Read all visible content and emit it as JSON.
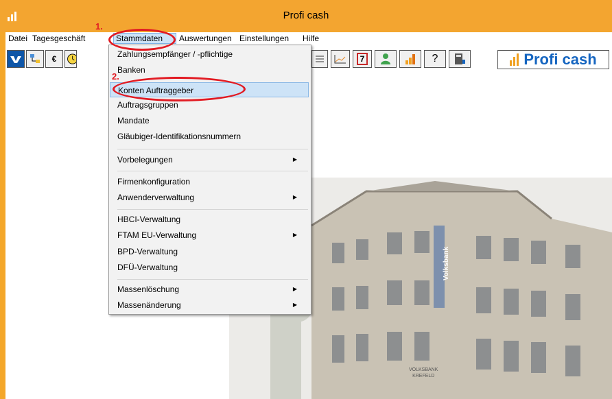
{
  "window": {
    "title": "Profi cash"
  },
  "menubar": {
    "items": [
      {
        "label": "Datei"
      },
      {
        "label": "Tagesgeschäft"
      },
      {
        "label": "Stammdaten"
      },
      {
        "label": "Auswertungen"
      },
      {
        "label": "Einstellungen"
      },
      {
        "label": "Hilfe"
      }
    ]
  },
  "toolbar": {
    "euro": "€",
    "calendar": "7",
    "help": "?",
    "logo": "Profi cash"
  },
  "dropdown": {
    "items": [
      {
        "label": "Zahlungsempfänger / -pflichtige"
      },
      {
        "label": "Banken"
      },
      {
        "label": "Konten Auftraggeber"
      },
      {
        "label": "Auftragsgruppen"
      },
      {
        "label": "Mandate"
      },
      {
        "label": "Gläubiger-Identifikationsnummern"
      },
      {
        "label": "Vorbelegungen"
      },
      {
        "label": "Firmenkonfiguration"
      },
      {
        "label": "Anwenderverwaltung"
      },
      {
        "label": "HBCI-Verwaltung"
      },
      {
        "label": "FTAM EU-Verwaltung"
      },
      {
        "label": "BPD-Verwaltung"
      },
      {
        "label": "DFÜ-Verwaltung"
      },
      {
        "label": "Massenlöschung"
      },
      {
        "label": "Massenänderung"
      }
    ]
  },
  "annotations": {
    "step1": "1.",
    "step2": "2."
  },
  "photo": {
    "sign": "Volksbank",
    "plaque_line1": "VOLKSBANK",
    "plaque_line2": "KREFELD"
  },
  "colors": {
    "titlebar": "#f3a530",
    "highlight": "#cde3f7",
    "annotation": "#e21b23",
    "logo": "#1565c0"
  }
}
